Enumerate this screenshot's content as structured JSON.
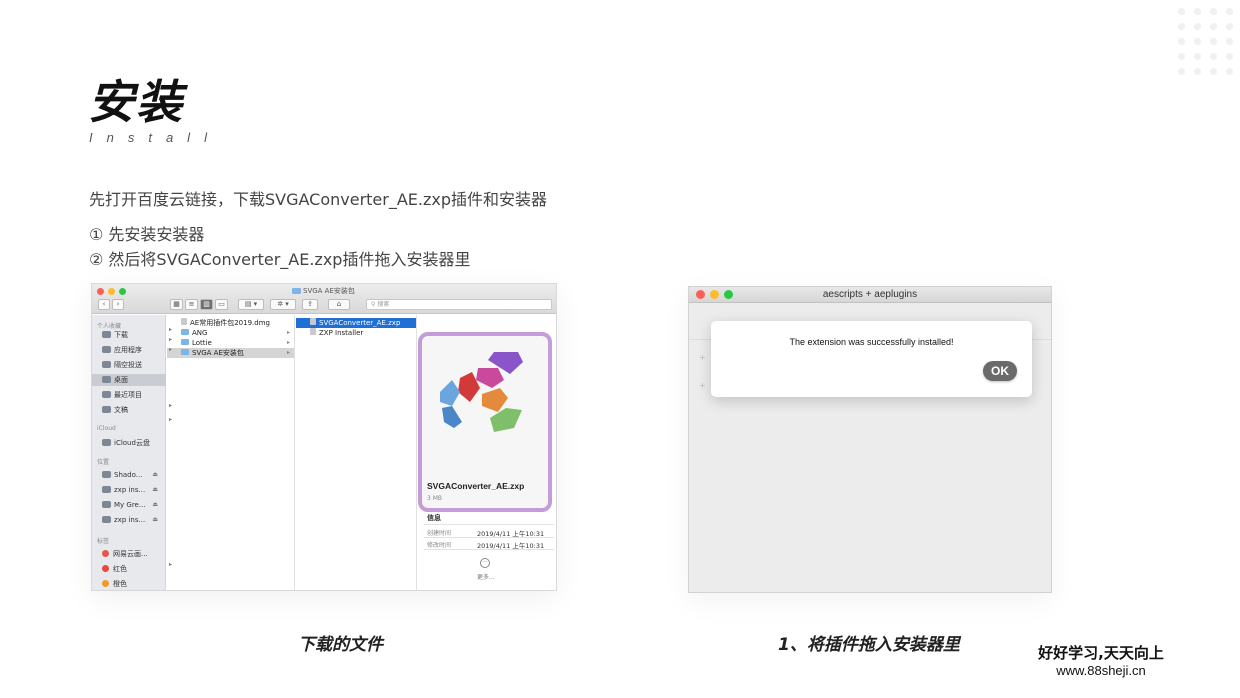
{
  "title": "安装",
  "subtitle": "Install",
  "description": "先打开百度云链接，下载SVGAConverter_AE.zxp插件和安装器",
  "steps": [
    "① 先安装安装器",
    "② 然后将SVGAConverter_AE.zxp插件拖入安装器里"
  ],
  "finder": {
    "window_title": "SVGA AE安装包",
    "search_placeholder": "搜索",
    "sidebar": {
      "favorites_header": "个人收藏",
      "favorites": [
        "下载",
        "应用程序",
        "隔空投送",
        "桌面",
        "最近项目",
        "文稿"
      ],
      "icloud_header": "iCloud",
      "icloud": [
        "iCloud云盘"
      ],
      "locations_header": "位置",
      "locations": [
        "Shado...",
        "zxp ins...",
        "My Gre...",
        "zxp ins..."
      ],
      "tags_header": "标签",
      "tags": [
        {
          "label": "网易云画...",
          "color": "#e05a4a"
        },
        {
          "label": "红色",
          "color": "#e8483d"
        },
        {
          "label": "橙色",
          "color": "#f0982c"
        }
      ]
    },
    "column1": [
      "AE常用插件包2019.dmg",
      "ANG",
      "Lottie",
      "SVGA AE安装包"
    ],
    "column2": [
      "SVGAConverter_AE.zxp",
      "ZXP Installer"
    ],
    "preview": {
      "file_name": "SVGAConverter_AE.zxp",
      "file_size": "3 MB",
      "info_header": "信息",
      "created_label": "创建时间",
      "created_value": "2019/4/11 上午10:31",
      "modified_label": "修改时间",
      "modified_value": "2019/4/11 上午10:31",
      "more_label": "更多..."
    }
  },
  "installer": {
    "window_title": "aescripts + aeplugins",
    "message": "The extension was successfully installed!",
    "ok_label": "OK"
  },
  "captions": [
    "下载的文件",
    "1、将插件拖入安装器里"
  ],
  "watermark": {
    "line1": "好好学习,天天向上",
    "line2": "www.88sheji.cn"
  }
}
